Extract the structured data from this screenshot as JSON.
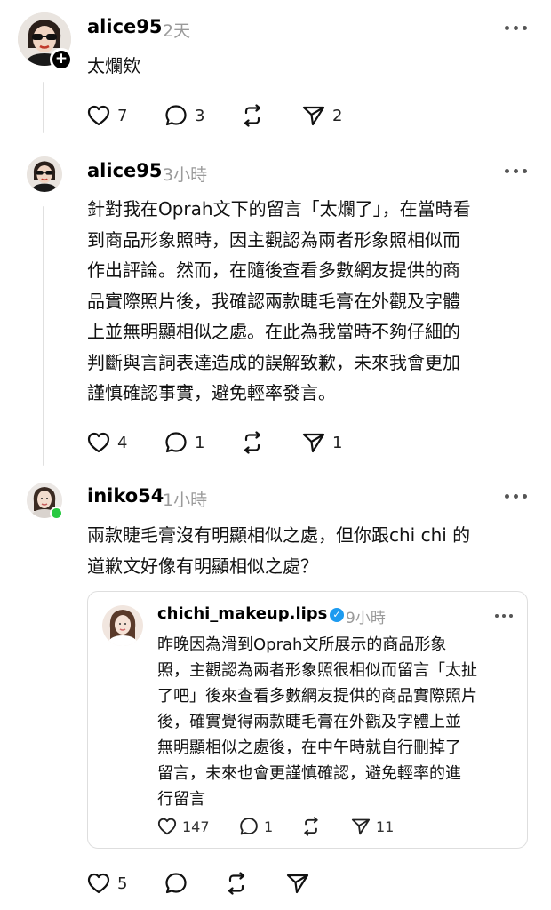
{
  "colors": {
    "accent": "#000000",
    "muted": "#9a9a9a",
    "divider": "#e0e0e0",
    "verified": "#1d9bf0",
    "online": "#28c941"
  },
  "posts": [
    {
      "username": "alice95",
      "time": "2天",
      "text": "太爛欸",
      "likes": "7",
      "replies": "3",
      "shares": "2",
      "avatar": "woman-sunglasses-avatar",
      "badge": "+"
    },
    {
      "username": "alice95",
      "time": "3小時",
      "text": "針對我在Oprah文下的留言「太爛了」，在當時看\n到商品形象照時，因主觀認為兩者形象照相似而\n作出評論。然而，在隨後查看多數網友提供的商\n品實際照片後，我確認兩款睫毛膏在外觀及字體\n上並無明顯相似之處。在此為我當時不夠仔細的\n判斷與言詞表達造成的誤解致歉，未來我會更加\n謹慎確認事實，避免輕率發言。",
      "likes": "4",
      "replies": "1",
      "shares": "1",
      "avatar": "woman-sunglasses-avatar"
    },
    {
      "username": "iniko54",
      "time": "1小時",
      "text": "兩款睫毛膏沒有明顯相似之處，但你跟chi chi 的\n道歉文好像有明顯相似之處？",
      "likes": "5",
      "avatar": "woman-selfie-avatar",
      "quote": {
        "username": "chichi_makeup.lips",
        "verified": "✓",
        "time": "9小時",
        "text": "昨晚因為滑到Oprah文所展示的商品形象\n照，主觀認為兩者形象照很相似而留言「太扯\n了吧」後來查看多數網友提供的商品實際照片\n後，確實覺得兩款睫毛膏在外觀及字體上並\n無明顯相似之處後，在中午時就自行刪掉了\n留言，未來也會更謹慎確認，避免輕率的進\n行留言",
        "likes": "147",
        "replies": "1",
        "shares": "11"
      }
    }
  ]
}
